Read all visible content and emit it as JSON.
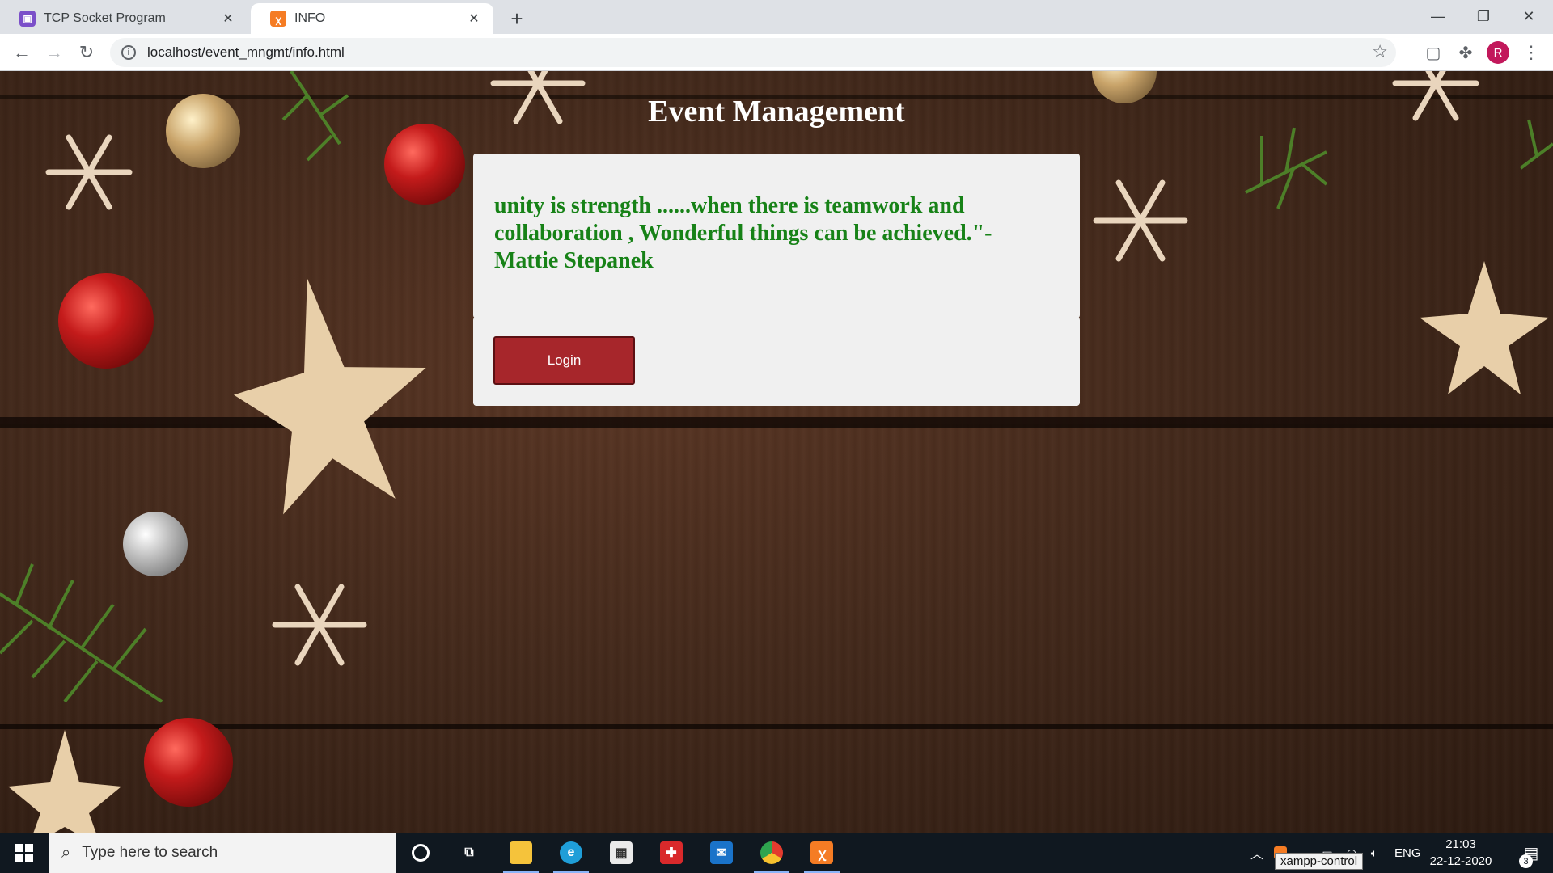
{
  "browser": {
    "tabs": [
      {
        "title": "TCP Socket Program",
        "active": false
      },
      {
        "title": "INFO",
        "active": true
      }
    ],
    "url": "localhost/event_mngmt/info.html",
    "profile_initial": "R"
  },
  "page": {
    "title": "Event Management",
    "quote": "unity is strength ......when there is teamwork and collaboration , Wonderful things can be achieved.\"- Mattie Stepanek",
    "login_label": "Login",
    "colors": {
      "quote_text": "#178217",
      "button_bg": "#a7262b",
      "panel_bg": "#f0f0f0"
    }
  },
  "taskbar": {
    "search_placeholder": "Type here to search",
    "tooltip": "xampp-control",
    "language": "ENG",
    "time": "21:03",
    "date": "22-12-2020",
    "notification_count": "3",
    "pinned_apps": [
      "cortana-icon",
      "task-view-icon",
      "file-explorer-icon",
      "edge-icon",
      "store-icon",
      "gift-icon",
      "mail-icon",
      "chrome-icon",
      "xampp-icon"
    ]
  }
}
